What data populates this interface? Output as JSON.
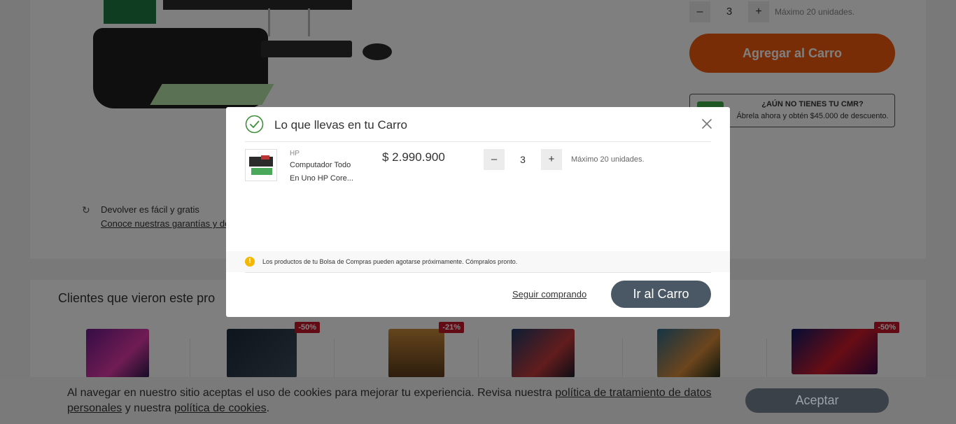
{
  "background": {
    "quantity": {
      "minus_label": "–",
      "value": "3",
      "plus_label": "+",
      "max_text": "Máximo 20 unidades."
    },
    "add_to_cart_label": "Agregar al Carro",
    "cmr": {
      "title": "¿AÚN NO TIENES TU CMR?",
      "subtitle": "Ábrela ahora y obtén $45.000 de descuento."
    },
    "returns": {
      "title": "Devolver es fácil y gratis",
      "link": "Conoce nuestras garantías y derecho"
    },
    "recommendations": {
      "title": "Clientes que vieron este pro",
      "discounts": [
        "-50%",
        "-21%",
        "-50%"
      ]
    }
  },
  "modal": {
    "title": "Lo que llevas en tu Carro",
    "item": {
      "brand": "HP",
      "name": "Computador Todo En Uno HP Core...",
      "price": "$ 2.990.900",
      "quantity": "3",
      "minus_label": "–",
      "plus_label": "+",
      "max_text": "Máximo 20 unidades."
    },
    "warning": "Los productos de tu Bolsa de Compras pueden agotarse próximamente. Cómpralos pronto.",
    "keep_shopping_label": "Seguir comprando",
    "go_cart_label": "Ir al Carro"
  },
  "cookie": {
    "text_start": "Al navegar en nuestro sitio aceptas el uso de cookies para mejorar tu experiencia. Revisa nuestra ",
    "link1": "política de tratamiento de datos personales",
    "text_mid": " y nuestra ",
    "link2": "política de cookies",
    "text_end": ".",
    "accept_label": "Aceptar"
  },
  "colors": {
    "accent": "#f15a0c",
    "primary_button": "#4a5866",
    "success": "#3f8f3a",
    "discount": "#c4162a",
    "warning": "#f5b800"
  }
}
